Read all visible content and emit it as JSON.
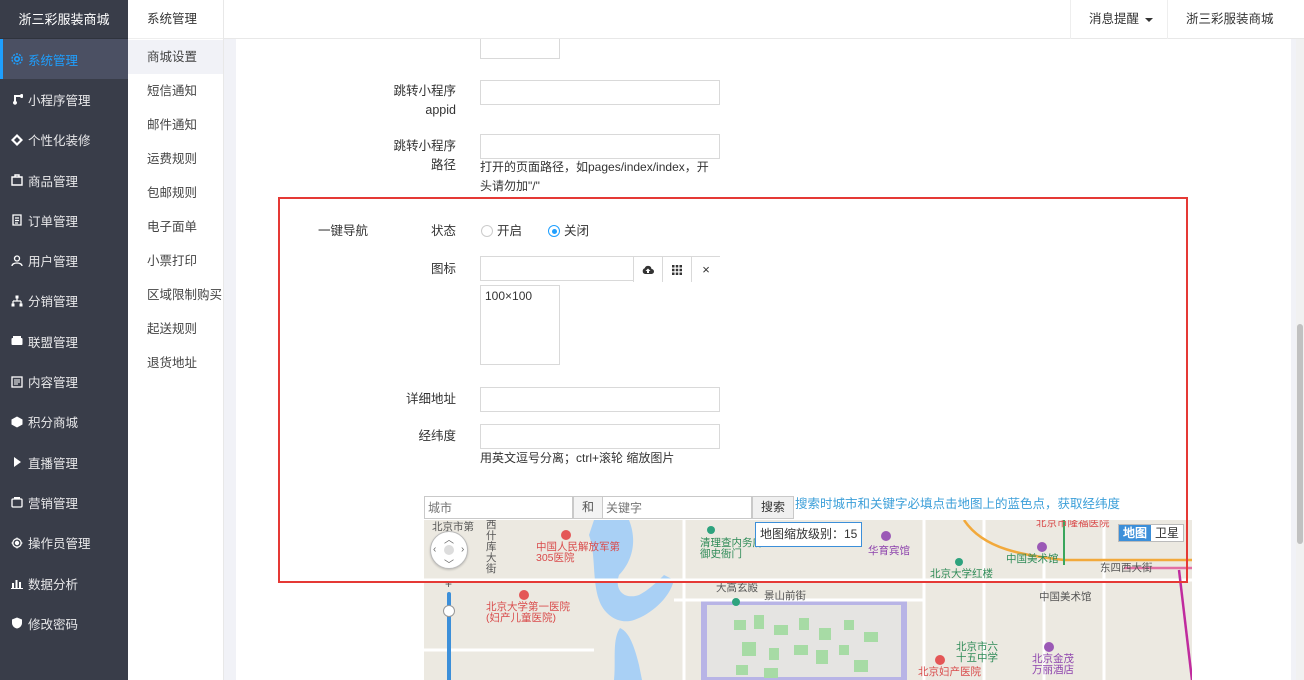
{
  "brand": "浙三彩服装商城",
  "sidebar": {
    "items": [
      {
        "label": "系统管理",
        "icon": "gear-icon",
        "active": true
      },
      {
        "label": "小程序管理",
        "icon": "miniapp-icon"
      },
      {
        "label": "个性化装修",
        "icon": "decoration-icon"
      },
      {
        "label": "商品管理",
        "icon": "goods-icon"
      },
      {
        "label": "订单管理",
        "icon": "order-icon"
      },
      {
        "label": "用户管理",
        "icon": "user-icon"
      },
      {
        "label": "分销管理",
        "icon": "distribution-icon"
      },
      {
        "label": "联盟管理",
        "icon": "alliance-icon"
      },
      {
        "label": "内容管理",
        "icon": "content-icon"
      },
      {
        "label": "积分商城",
        "icon": "points-icon"
      },
      {
        "label": "直播管理",
        "icon": "live-icon"
      },
      {
        "label": "营销管理",
        "icon": "marketing-icon"
      },
      {
        "label": "操作员管理",
        "icon": "operator-icon"
      },
      {
        "label": "数据分析",
        "icon": "analytics-icon"
      },
      {
        "label": "修改密码",
        "icon": "password-icon"
      }
    ]
  },
  "subbar": {
    "title": "系统管理",
    "items": [
      {
        "label": "商城设置",
        "active": true
      },
      {
        "label": "短信通知"
      },
      {
        "label": "邮件通知"
      },
      {
        "label": "运费规则"
      },
      {
        "label": "包邮规则"
      },
      {
        "label": "电子面单"
      },
      {
        "label": "小票打印"
      },
      {
        "label": "区域限制购买"
      },
      {
        "label": "起送规则"
      },
      {
        "label": "退货地址"
      }
    ]
  },
  "header": {
    "messages": "消息提醒",
    "shop": "浙三彩服装商城"
  },
  "form": {
    "jump_appid_label_1": "跳转小程序",
    "jump_appid_label_2": "appid",
    "jump_path_label_1": "跳转小程序",
    "jump_path_label_2": "路径",
    "jump_path_help_1": "打开的页面路径，如pages/index/index，开",
    "jump_path_help_2": "头请勿加\"/\"",
    "section_title": "一键导航",
    "status_label": "状态",
    "status_on": "开启",
    "status_off": "关闭",
    "status_value": "关闭",
    "icon_label": "图标",
    "icon_size": "100×100",
    "address_label": "详细地址",
    "latlng_label": "经纬度",
    "latlng_help": "用英文逗号分离；ctrl+滚轮 缩放图片"
  },
  "map": {
    "city_placeholder": "城市",
    "and_label": "和",
    "keyword_placeholder": "关键字",
    "search_label": "搜索",
    "tip": "搜索时城市和关键字必填点击地图上的蓝色点，获取经纬度",
    "zoom_label": "地图缩放级别：15",
    "type_map": "地图",
    "type_satellite": "卫星",
    "poi": [
      "北京市第",
      "西什库大街",
      "中国人民解放军第305医院",
      "清理查内务府御史衙门",
      "北京市隆福医院",
      "华育宾馆",
      "中国美术馆",
      "北京大学红楼",
      "东四西大街",
      "大高玄殿",
      "景山前街",
      "北京大学第一医院(妇产儿童医院)",
      "中国美术馆",
      "北京市六十五中学",
      "北京金茂万丽酒店",
      "北京妇产医院"
    ]
  },
  "colors": {
    "sidebar_bg": "#393d49",
    "accent": "#1e9fff",
    "highlight_box": "#e53935"
  }
}
